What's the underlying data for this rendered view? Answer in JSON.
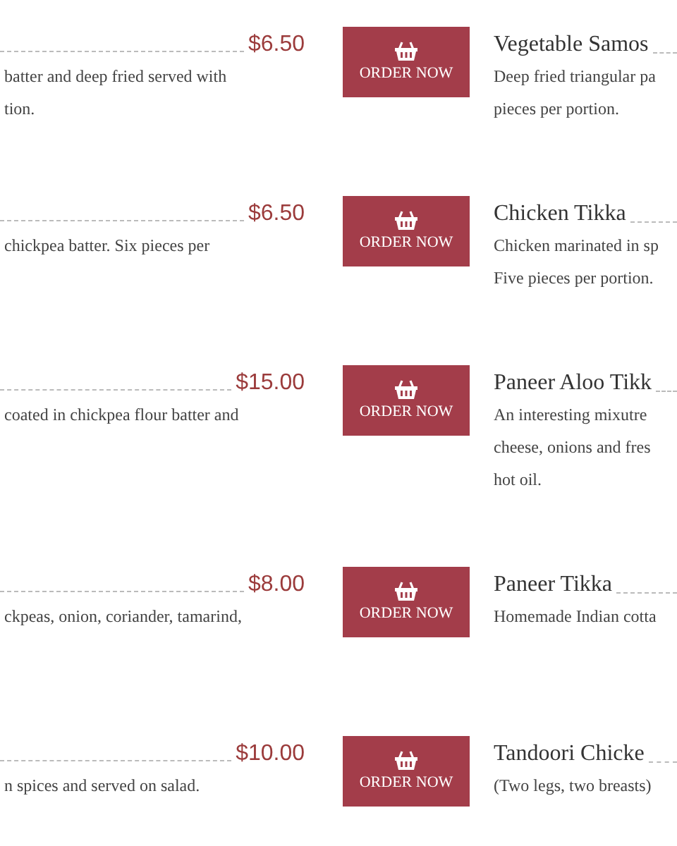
{
  "rows": [
    {
      "left": {
        "price": "$6.50",
        "desc_lines": [
          "batter and deep fried served with",
          "tion."
        ]
      },
      "button": "ORDER NOW",
      "item": {
        "name": "Vegetable Samos",
        "desc_lines": [
          "Deep fried triangular pa",
          "pieces per portion."
        ]
      }
    },
    {
      "left": {
        "price": "$6.50",
        "desc_lines": [
          "chickpea batter. Six pieces per"
        ]
      },
      "button": "ORDER NOW",
      "item": {
        "name": "Chicken Tikka",
        "desc_lines": [
          "Chicken marinated in sp",
          "Five pieces per portion."
        ]
      }
    },
    {
      "left": {
        "price": "$15.00",
        "desc_lines": [
          "coated in chickpea flour batter and"
        ]
      },
      "button": "ORDER NOW",
      "item": {
        "name": "Paneer Aloo Tikk",
        "desc_lines": [
          "An interesting mixutre",
          "cheese, onions and fres",
          "hot oil."
        ]
      }
    },
    {
      "left": {
        "price": "$8.00",
        "desc_lines": [
          "ckpeas, onion, coriander, tamarind,"
        ]
      },
      "button": "ORDER NOW",
      "item": {
        "name": "Paneer Tikka",
        "desc_lines": [
          "Homemade Indian cotta"
        ]
      }
    },
    {
      "left": {
        "price": "$10.00",
        "desc_lines": [
          "n spices and served on salad."
        ]
      },
      "button": "ORDER NOW",
      "item": {
        "name": "Tandoori Chicke",
        "desc_lines": [
          "(Two legs, two breasts)"
        ]
      }
    }
  ]
}
